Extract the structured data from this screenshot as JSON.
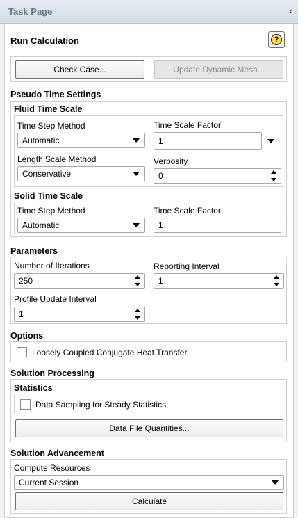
{
  "titlebar": {
    "title": "Task Page",
    "collapse_glyph": "‹"
  },
  "run_calc": {
    "title": "Run Calculation",
    "help_glyph": "?"
  },
  "buttons": {
    "check_case": "Check Case...",
    "update_mesh": "Update Dynamic Mesh..."
  },
  "pseudo": {
    "title": "Pseudo Time Settings",
    "fluid": {
      "title": "Fluid Time Scale",
      "time_step_method_label": "Time Step Method",
      "time_step_method_value": "Automatic",
      "time_scale_factor_label": "Time Scale Factor",
      "time_scale_factor_value": "1",
      "length_scale_method_label": "Length Scale Method",
      "length_scale_method_value": "Conservative",
      "verbosity_label": "Verbosity",
      "verbosity_value": "0"
    },
    "solid": {
      "title": "Solid Time Scale",
      "time_step_method_label": "Time Step Method",
      "time_step_method_value": "Automatic",
      "time_scale_factor_label": "Time Scale Factor",
      "time_scale_factor_value": "1"
    }
  },
  "parameters": {
    "title": "Parameters",
    "iterations_label": "Number of Iterations",
    "iterations_value": "250",
    "reporting_label": "Reporting Interval",
    "reporting_value": "1",
    "profile_label": "Profile Update Interval",
    "profile_value": "1"
  },
  "options": {
    "title": "Options",
    "loosely_coupled_label": "Loosely Coupled Conjugate Heat Transfer"
  },
  "processing": {
    "title": "Solution Processing",
    "statistics_title": "Statistics",
    "data_sampling_label": "Data Sampling for Steady Statistics",
    "data_file_button": "Data File Quantities..."
  },
  "advancement": {
    "title": "Solution Advancement",
    "compute_label": "Compute Resources",
    "compute_value": "Current Session",
    "calculate_button": "Calculate"
  }
}
